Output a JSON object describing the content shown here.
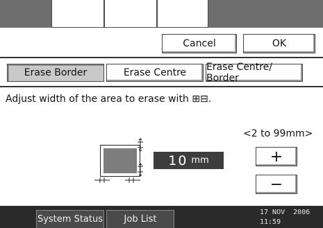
{
  "actions": {
    "cancel_label": "Cancel",
    "ok_label": "OK"
  },
  "tabs": [
    {
      "label": "Erase Border",
      "selected": true
    },
    {
      "label": "Erase Centre",
      "selected": false
    },
    {
      "label": "Erase Centre/ Border",
      "selected": false
    }
  ],
  "instruction": {
    "text": "Adjust width of the area to erase with ⊞⊟."
  },
  "width_setting": {
    "range_label": "<2 to 99mm>",
    "value": "10",
    "unit": "mm",
    "increase_label": "+",
    "decrease_label": "−"
  },
  "status_bar": {
    "system_status_label": "System Status",
    "job_list_label": "Job List",
    "date": "17 NOV  2006",
    "time": "11:59"
  },
  "colors": {
    "selected_tab": "#c9c9c9",
    "value_box": "#3d3d3d",
    "status_bar": "#2a2a2a"
  }
}
